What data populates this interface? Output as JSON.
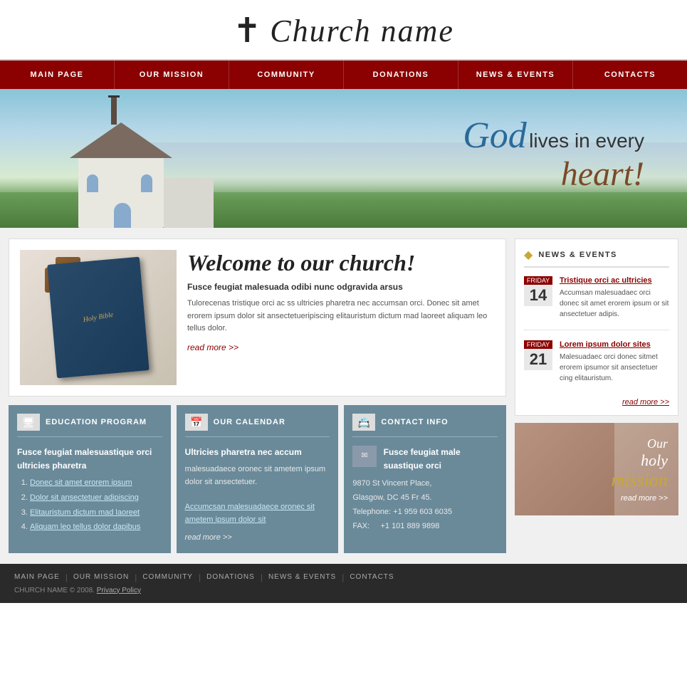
{
  "header": {
    "cross": "✝",
    "title": "Church name"
  },
  "nav": {
    "items": [
      {
        "label": "MAIN PAGE",
        "id": "nav-main-page"
      },
      {
        "label": "OUR MISSION",
        "id": "nav-our-mission"
      },
      {
        "label": "COMMUNITY",
        "id": "nav-community"
      },
      {
        "label": "DONATIONS",
        "id": "nav-donations"
      },
      {
        "label": "NEWS & EVENTS",
        "id": "nav-news-events"
      },
      {
        "label": "CONTACTS",
        "id": "nav-contacts"
      }
    ]
  },
  "hero": {
    "god": "God",
    "subtitle": "lives in every",
    "heart": "heart!"
  },
  "welcome": {
    "title_script": "Welcome",
    "title_rest": " to our church!",
    "subtitle": "Fusce feugiat malesuada odibi nunc odgravida arsus",
    "body": "Tulorecenas tristique orci ac ss ultricies pharetra nec accumsan orci. Donec sit amet erorem ipsum dolor sit ansectetueripiscing elitauristum dictum mad laoreet aliquam leo tellus dolor.",
    "read_more": "read more >>"
  },
  "columns": {
    "education": {
      "title": "EDUCATION PROGRAM",
      "icon": "🖥",
      "subtitle": "Fusce feugiat malesuastique orci ultricies pharetra",
      "links": [
        "Donec sit amet erorem ipsum",
        "Dolor sit ansectetuer adipiscing",
        "Elitauristum dictum mad laoreet",
        "Aliquam leo tellus dolor dapibus"
      ]
    },
    "calendar": {
      "title": "OUR CALENDAR",
      "icon": "📅",
      "main_title": "Ultricies pharetra nec accum",
      "main_body": "malesuadaece oronec sit ametem ipsum dolor sit ansectetuer.",
      "link_text": "Accumcsan malesuadaece oronec sit ametem ipsum dolor sit",
      "read_more": "read more >>"
    },
    "contact": {
      "title": "CONTACT INFO",
      "icon": "📇",
      "contact_title": "Fusce feugiat male suastique orci",
      "address": "9870 St Vincent Place,",
      "city": "Glasgow, DC 45 Fr 45.",
      "telephone_label": "Telephone:",
      "telephone": "+1 959 603 6035",
      "fax_label": "FAX:",
      "fax": "+1 101 889 9898"
    }
  },
  "sidebar": {
    "news_events_title": "NEWS & EVENTS",
    "items": [
      {
        "day_label": "Friday",
        "day_num": "14",
        "title": "Tristique orci ac ultricies",
        "body": "Accumsan malesuadaec orci donec sit amet erorem ipsum or sit ansectetuer adipis."
      },
      {
        "day_label": "Friday",
        "day_num": "21",
        "title": "Lorem ipsum dolor sites",
        "body": "Malesuadaec orci donec sitmet erorem ipsumor sit ansectetuer cing elitauristum."
      }
    ],
    "read_more": "read more >>",
    "mission": {
      "our": "Our",
      "holy": "holy",
      "word": "mission",
      "read_more": "read more >>"
    }
  },
  "footer": {
    "nav": [
      "MAIN PAGE",
      "OUR MISSION",
      "COMMUNITY",
      "DONATIONS",
      "NEWS & EVENTS",
      "CONTACTS"
    ],
    "copyright": "CHURCH NAME © 2008.",
    "privacy": "Privacy Policy"
  }
}
